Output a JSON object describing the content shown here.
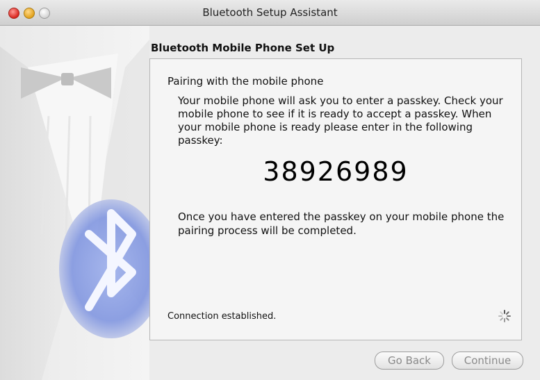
{
  "window": {
    "title": "Bluetooth Setup Assistant"
  },
  "section_title": "Bluetooth Mobile Phone Set Up",
  "panel": {
    "heading": "Pairing with the mobile phone",
    "instructions": "Your mobile phone will ask you to enter a passkey. Check your mobile phone to see if it is ready to accept a passkey. When your mobile phone is ready please enter in the following passkey:",
    "passkey": "38926989",
    "completion_text": "Once you have entered the passkey on your mobile phone the pairing process will be completed.",
    "status": "Connection established."
  },
  "buttons": {
    "back_label": "Go Back",
    "continue_label": "Continue"
  },
  "icons": {
    "spinner": "activity-spinner-icon",
    "artwork": "bluetooth-logo-icon"
  },
  "colors": {
    "bluetooth_blue": "#7e95e0",
    "window_background": "#ececec",
    "disabled_text": "#8a8a8a"
  }
}
